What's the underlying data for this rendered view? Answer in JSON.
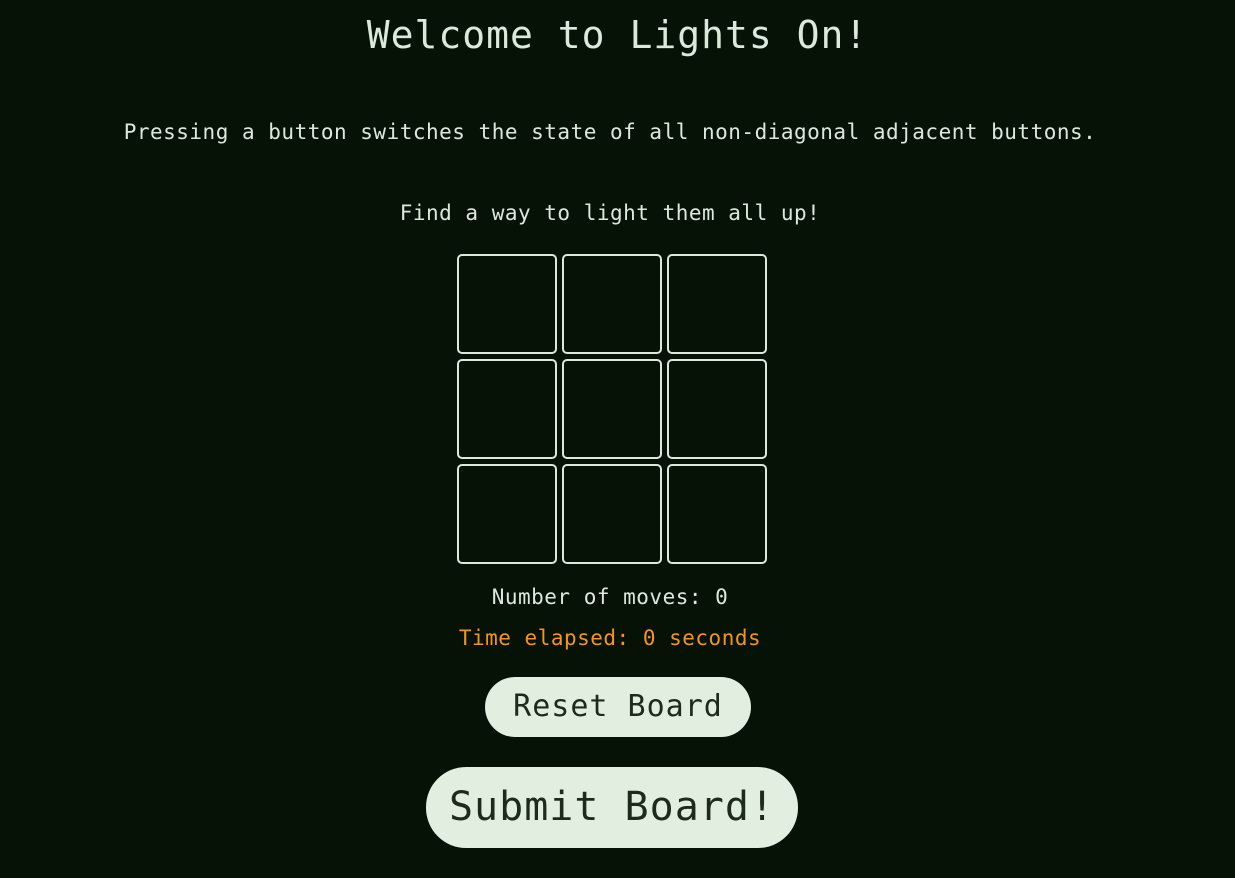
{
  "header": {
    "title": "Welcome to Lights On!"
  },
  "instructions": {
    "rule": "Pressing a button switches the state of all non-diagonal adjacent buttons.",
    "goal": "Find a way to light them all up!"
  },
  "board": {
    "rows": 3,
    "cols": 3,
    "cells": [
      [
        false,
        false,
        false
      ],
      [
        false,
        false,
        false
      ],
      [
        false,
        false,
        false
      ]
    ]
  },
  "stats": {
    "moves_text": "Number of moves: 0",
    "time_text": "Time elapsed: 0 seconds"
  },
  "actions": {
    "reset_label": "Reset Board",
    "submit_label": "Submit Board!"
  },
  "colors": {
    "background": "#071207",
    "text": "#dbe9da",
    "timer": "#f2951d",
    "button_bg": "#e2eedf",
    "button_text": "#1d2b1c"
  }
}
